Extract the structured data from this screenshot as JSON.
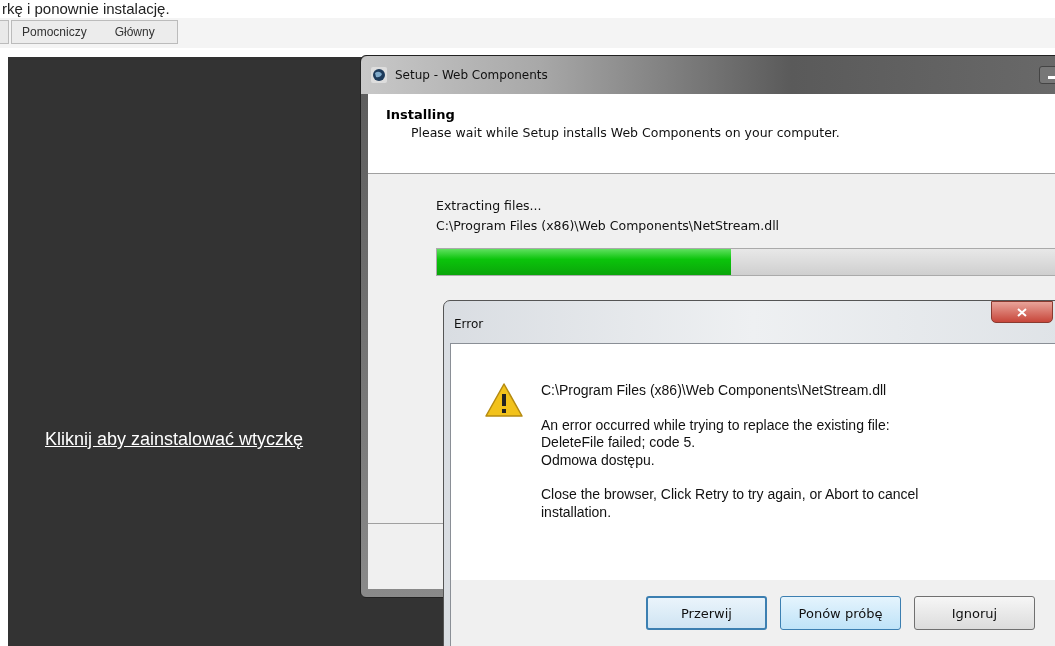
{
  "page_heading": "rkę i ponownie instalację.",
  "tabs": [
    {
      "label": "Pomocniczy",
      "selected": false
    },
    {
      "label": "Główny",
      "selected": false
    }
  ],
  "install_link": "Kliknij aby zainstalować wtyczkę",
  "setup_window": {
    "title": "Setup - Web Components",
    "heading": "Installing",
    "subheading": "Please wait while Setup installs Web Components on your computer.",
    "status": "Extracting files...",
    "file": "C:\\Program Files (x86)\\Web Components\\NetStream.dll",
    "progress": {
      "level": 0.46
    }
  },
  "error_dialog": {
    "title": "Error",
    "lines": [
      "C:\\Program Files (x86)\\Web Components\\NetStream.dll",
      "An error occurred while trying to replace the existing file:\nDeleteFile failed; code 5.\nOdmowa dostępu.",
      "Close the browser, Click Retry to try again, or Abort to cancel installation."
    ],
    "buttons": [
      {
        "label": "Przerwij",
        "focused": true,
        "hovered": false
      },
      {
        "label": "Ponów próbę",
        "focused": false,
        "hovered": true
      },
      {
        "label": "Ignoruj",
        "focused": false,
        "hovered": false
      }
    ]
  }
}
